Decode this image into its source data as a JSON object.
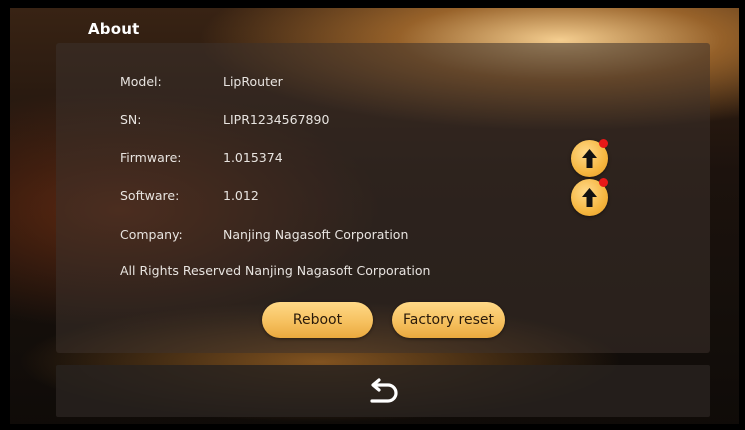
{
  "page_title": "About",
  "info": [
    {
      "label": "Model:",
      "value": "LipRouter"
    },
    {
      "label": "SN:",
      "value": "LIPR1234567890"
    },
    {
      "label": "Firmware:",
      "value": "1.015374"
    },
    {
      "label": "Software:",
      "value": "1.012"
    },
    {
      "label": "Company:",
      "value": "Nanjing Nagasoft Corporation"
    }
  ],
  "rights_text": "All Rights Reserved Nanjing Nagasoft Corporation",
  "buttons": {
    "reboot": "Reboot",
    "factory_reset": "Factory reset"
  },
  "icons": {
    "firmware_update": "upload-arrow-icon",
    "software_update": "upload-arrow-icon",
    "back": "back-arrow-icon",
    "notification": "red-dot"
  },
  "colors": {
    "accent": "#f6c160",
    "notification": "#e81818",
    "text": "#e8e4e0"
  }
}
